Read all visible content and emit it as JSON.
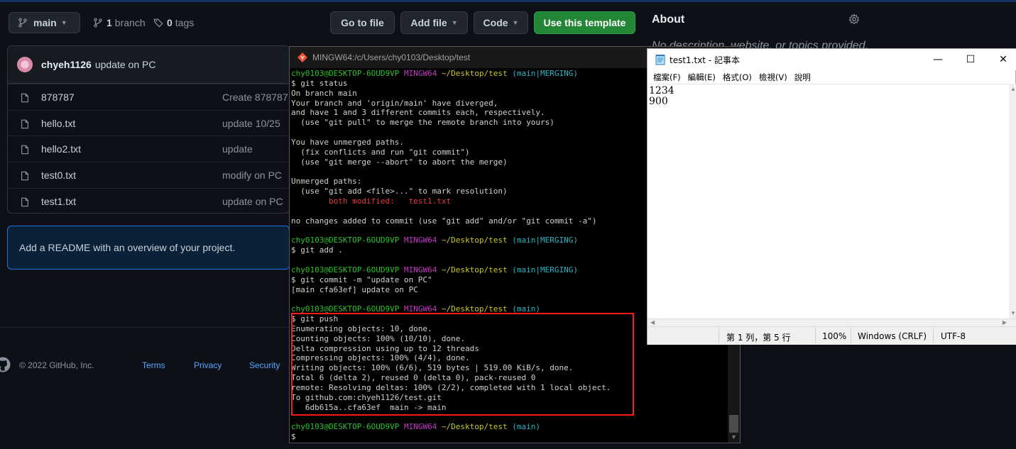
{
  "github": {
    "branch": {
      "name": "main",
      "count_num": "1",
      "count_label": "branch",
      "tags_num": "0",
      "tags_label": "tags"
    },
    "buttons": {
      "go_to_file": "Go to file",
      "add_file": "Add file",
      "code": "Code",
      "use_template": "Use this template"
    },
    "about": {
      "title": "About",
      "description": "No description, website, or topics provided."
    },
    "latest_commit": {
      "user": "chyeh1126",
      "message": "update on PC"
    },
    "files": [
      {
        "name": "878787",
        "commit": "Create 878787"
      },
      {
        "name": "hello.txt",
        "commit": "update 10/25"
      },
      {
        "name": "hello2.txt",
        "commit": "update"
      },
      {
        "name": "test0.txt",
        "commit": "modify on PC"
      },
      {
        "name": "test1.txt",
        "commit": "update on PC"
      }
    ],
    "readme_prompt": "Add a README with an overview of your project.",
    "footer": {
      "copyright": "© 2022 GitHub, Inc.",
      "links": [
        "Terms",
        "Privacy",
        "Security"
      ]
    }
  },
  "terminal": {
    "title": "MINGW64:/c/Users/chy0103/Desktop/test",
    "prompt": {
      "userhost": "chy0103@DESKTOP-6OUD9VP",
      "shell": "MINGW64",
      "path": "~/Desktop/test"
    },
    "lines": [
      {
        "kind": "prompt",
        "branch": "(main|MERGING)"
      },
      {
        "kind": "text",
        "text": "$ git status"
      },
      {
        "kind": "text",
        "text": "On branch main"
      },
      {
        "kind": "text",
        "text": "Your branch and 'origin/main' have diverged,"
      },
      {
        "kind": "text",
        "text": "and have 1 and 3 different commits each, respectively."
      },
      {
        "kind": "text",
        "text": "  (use \"git pull\" to merge the remote branch into yours)"
      },
      {
        "kind": "text",
        "text": ""
      },
      {
        "kind": "text",
        "text": "You have unmerged paths."
      },
      {
        "kind": "text",
        "text": "  (fix conflicts and run \"git commit\")"
      },
      {
        "kind": "text",
        "text": "  (use \"git merge --abort\" to abort the merge)"
      },
      {
        "kind": "text",
        "text": ""
      },
      {
        "kind": "text",
        "text": "Unmerged paths:"
      },
      {
        "kind": "text",
        "text": "  (use \"git add <file>...\" to mark resolution)"
      },
      {
        "kind": "red",
        "text": "        both modified:   test1.txt"
      },
      {
        "kind": "text",
        "text": ""
      },
      {
        "kind": "text",
        "text": "no changes added to commit (use \"git add\" and/or \"git commit -a\")"
      },
      {
        "kind": "text",
        "text": ""
      },
      {
        "kind": "prompt",
        "branch": "(main|MERGING)"
      },
      {
        "kind": "text",
        "text": "$ git add ."
      },
      {
        "kind": "text",
        "text": ""
      },
      {
        "kind": "prompt",
        "branch": "(main|MERGING)"
      },
      {
        "kind": "text",
        "text": "$ git commit -m \"update on PC\""
      },
      {
        "kind": "text",
        "text": "[main cfa63ef] update on PC"
      },
      {
        "kind": "text",
        "text": ""
      },
      {
        "kind": "prompt",
        "branch": "(main)"
      },
      {
        "kind": "text",
        "text": "$ git push"
      },
      {
        "kind": "text",
        "text": "Enumerating objects: 10, done."
      },
      {
        "kind": "text",
        "text": "Counting objects: 100% (10/10), done."
      },
      {
        "kind": "text",
        "text": "Delta compression using up to 12 threads"
      },
      {
        "kind": "text",
        "text": "Compressing objects: 100% (4/4), done."
      },
      {
        "kind": "text",
        "text": "Writing objects: 100% (6/6), 519 bytes | 519.00 KiB/s, done."
      },
      {
        "kind": "text",
        "text": "Total 6 (delta 2), reused 0 (delta 0), pack-reused 0"
      },
      {
        "kind": "text",
        "text": "remote: Resolving deltas: 100% (2/2), completed with 1 local object."
      },
      {
        "kind": "text",
        "text": "To github.com:chyeh1126/test.git"
      },
      {
        "kind": "text",
        "text": "   6db615a..cfa63ef  main -> main"
      },
      {
        "kind": "text",
        "text": ""
      },
      {
        "kind": "prompt",
        "branch": "(main)"
      },
      {
        "kind": "text",
        "text": "$ "
      }
    ],
    "colors": {
      "userhost": "#29c329",
      "shell": "#c33bc3",
      "path": "#c8c829",
      "branch": "#28b6c3",
      "modified": "#e03c3c"
    }
  },
  "notepad": {
    "title": "test1.txt - 記事本",
    "menu": [
      "檔案(F)",
      "編輯(E)",
      "格式(O)",
      "檢視(V)",
      "說明"
    ],
    "content": "1234\n900",
    "status": {
      "position": "第 1 列，第 5 行",
      "zoom": "100%",
      "line_ending": "Windows (CRLF)",
      "encoding": "UTF-8"
    }
  }
}
